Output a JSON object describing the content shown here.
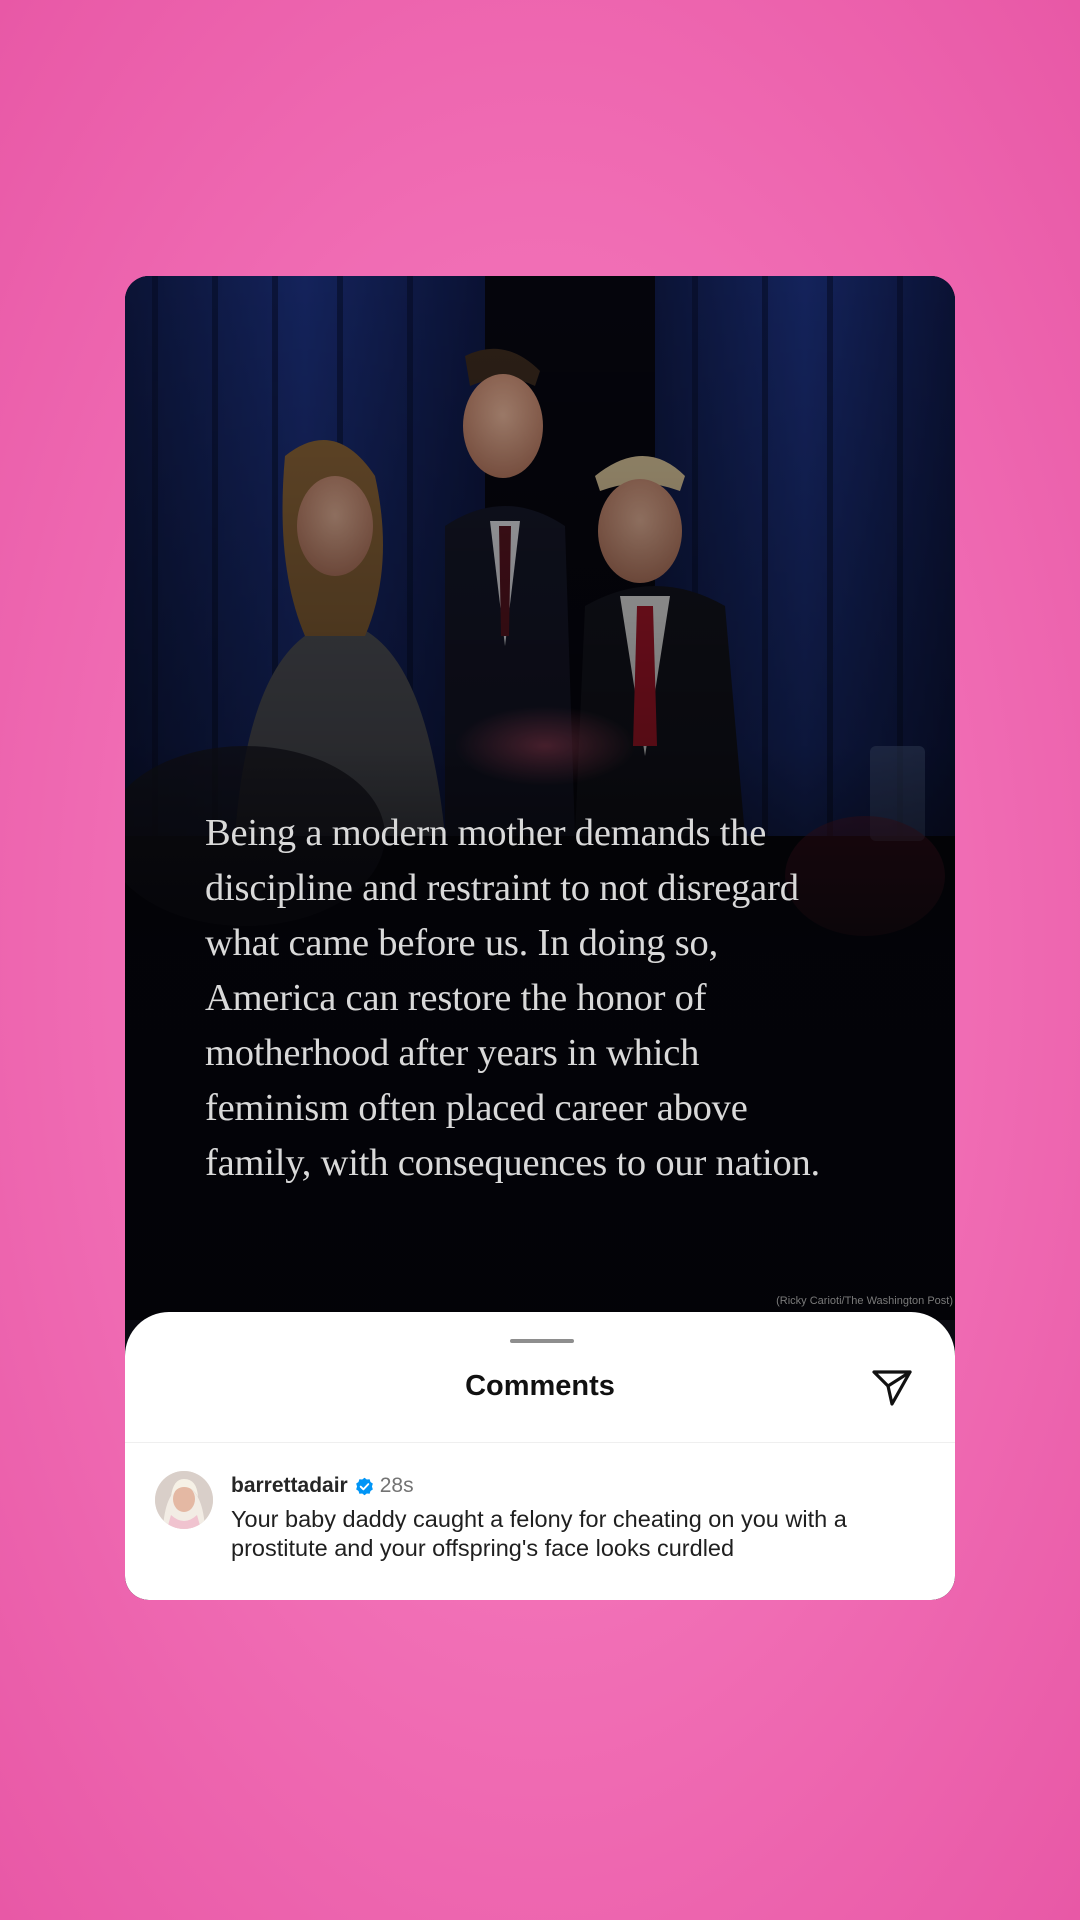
{
  "post": {
    "quote": "Being a modern mother demands the discipline and restraint to not disregard what came before us. In doing so, America can restore the honor of motherhood after years in which feminism often placed career above family, with consequences to our nation.",
    "photo_credit": "(Ricky Carioti/The Washington Post)"
  },
  "comments_sheet": {
    "title": "Comments",
    "share_icon": "paper-plane-icon"
  },
  "comments": [
    {
      "username": "barrettadair",
      "verified": true,
      "timestamp": "28s",
      "text": "Your baby daddy caught a felony for cheating on you with a prostitute and your offspring's face looks curdled"
    }
  ],
  "colors": {
    "background": "#f271b7",
    "verified_badge": "#0095f6",
    "sheet": "#ffffff"
  }
}
